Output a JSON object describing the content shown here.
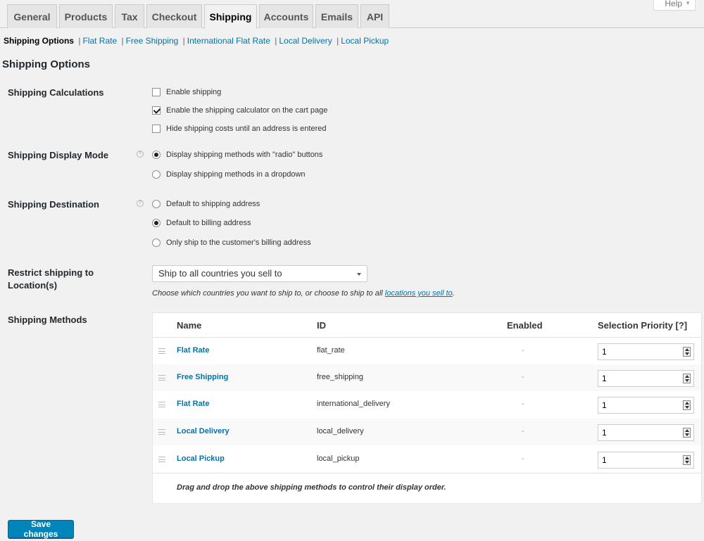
{
  "help": {
    "label": "Help"
  },
  "tabs": [
    {
      "label": "General"
    },
    {
      "label": "Products"
    },
    {
      "label": "Tax"
    },
    {
      "label": "Checkout"
    },
    {
      "label": "Shipping"
    },
    {
      "label": "Accounts"
    },
    {
      "label": "Emails"
    },
    {
      "label": "API"
    }
  ],
  "subnav": {
    "current": "Shipping Options",
    "links": [
      "Flat Rate",
      "Free Shipping",
      "International Flat Rate",
      "Local Delivery",
      "Local Pickup"
    ]
  },
  "page_title": "Shipping Options",
  "calculations": {
    "label": "Shipping Calculations",
    "options": [
      {
        "label": "Enable shipping",
        "checked": false
      },
      {
        "label": "Enable the shipping calculator on the cart page",
        "checked": true
      },
      {
        "label": "Hide shipping costs until an address is entered",
        "checked": false
      }
    ]
  },
  "display_mode": {
    "label": "Shipping Display Mode",
    "options": [
      {
        "label": "Display shipping methods with \"radio\" buttons",
        "checked": true
      },
      {
        "label": "Display shipping methods in a dropdown",
        "checked": false
      }
    ]
  },
  "destination": {
    "label": "Shipping Destination",
    "options": [
      {
        "label": "Default to shipping address",
        "checked": false
      },
      {
        "label": "Default to billing address",
        "checked": true
      },
      {
        "label": "Only ship to the customer's billing address",
        "checked": false
      }
    ]
  },
  "restrict": {
    "label_line1": "Restrict shipping to",
    "label_line2": "Location(s)",
    "selected": "Ship to all countries you sell to",
    "desc_prefix": "Choose which countries you want to ship to, or choose to ship to all ",
    "desc_link": "locations you sell to",
    "desc_suffix": "."
  },
  "methods": {
    "label": "Shipping Methods",
    "headers": {
      "name": "Name",
      "id": "ID",
      "enabled": "Enabled",
      "priority": "Selection Priority [?]"
    },
    "rows": [
      {
        "name": "Flat Rate",
        "id": "flat_rate",
        "enabled": "-",
        "priority": "1"
      },
      {
        "name": "Free Shipping",
        "id": "free_shipping",
        "enabled": "-",
        "priority": "1"
      },
      {
        "name": "Flat Rate",
        "id": "international_delivery",
        "enabled": "-",
        "priority": "1"
      },
      {
        "name": "Local Delivery",
        "id": "local_delivery",
        "enabled": "-",
        "priority": "1"
      },
      {
        "name": "Local Pickup",
        "id": "local_pickup",
        "enabled": "-",
        "priority": "1"
      }
    ],
    "footer": "Drag and drop the above shipping methods to control their display order."
  },
  "save_label": "Save changes"
}
